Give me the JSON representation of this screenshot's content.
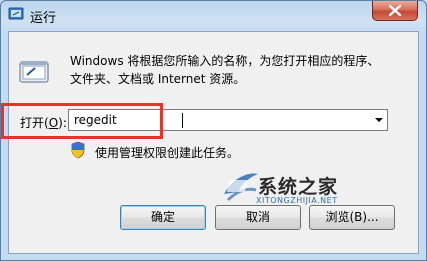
{
  "window": {
    "title": "运行"
  },
  "description": {
    "line1": "Windows 将根据您所输入的名称，为您打开相应的程序、",
    "line2": "文件夹、文档或 Internet 资源。"
  },
  "open_field": {
    "label_prefix": "打开(",
    "label_hotkey": "O",
    "label_suffix": "):",
    "value": "regedit"
  },
  "admin_note": "使用管理权限创建此任务。",
  "buttons": {
    "ok": "确定",
    "cancel": "取消",
    "browse": "浏览(B)..."
  },
  "watermark": {
    "name": "系统之家",
    "url": "XITONGZHIJIA.NET"
  },
  "colors": {
    "highlight_border": "#e8322c",
    "close_button": "#c44a32",
    "logo_blue": "#2f6fb1"
  }
}
